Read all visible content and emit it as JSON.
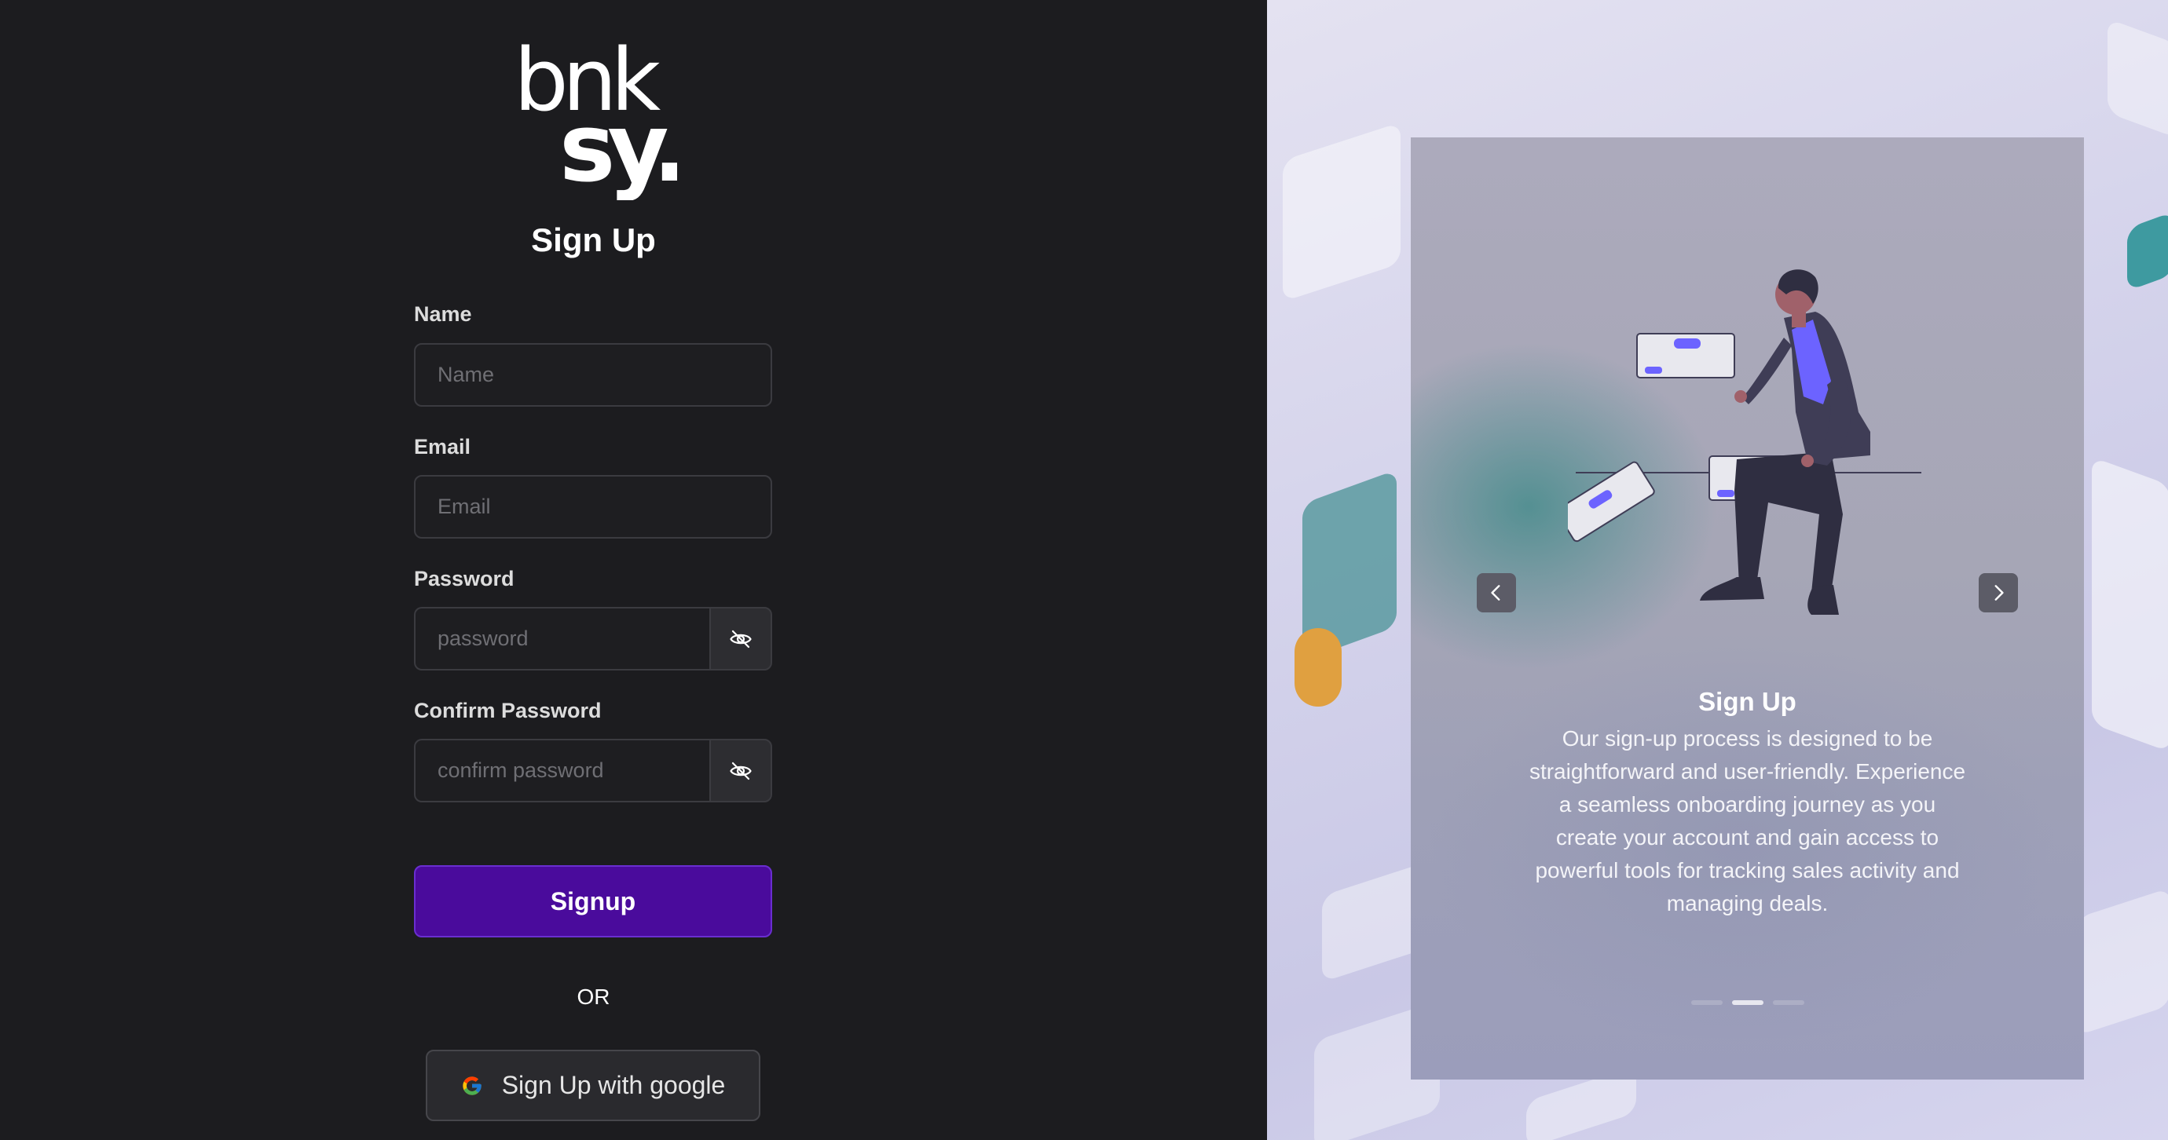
{
  "brand": {
    "logo_line1": "bnk",
    "logo_line2": "sy."
  },
  "form": {
    "title": "Sign Up",
    "name_label": "Name",
    "name_placeholder": "Name",
    "email_label": "Email",
    "email_placeholder": "Email",
    "password_label": "Password",
    "password_placeholder": "password",
    "confirm_label": "Confirm Password",
    "confirm_placeholder": "confirm password",
    "submit_label": "Signup",
    "divider": "OR",
    "google_label": "Sign Up with google"
  },
  "carousel": {
    "title": "Sign Up",
    "description": "Our sign-up process is designed to be straightforward and user-friendly. Experience a seamless onboarding journey as you create your account and gain access to powerful tools for tracking sales activity and managing deals.",
    "active_slide": 2,
    "slide_count": 3
  },
  "colors": {
    "accent": "#4a0b9c",
    "illustration_accent": "#6c63ff"
  }
}
